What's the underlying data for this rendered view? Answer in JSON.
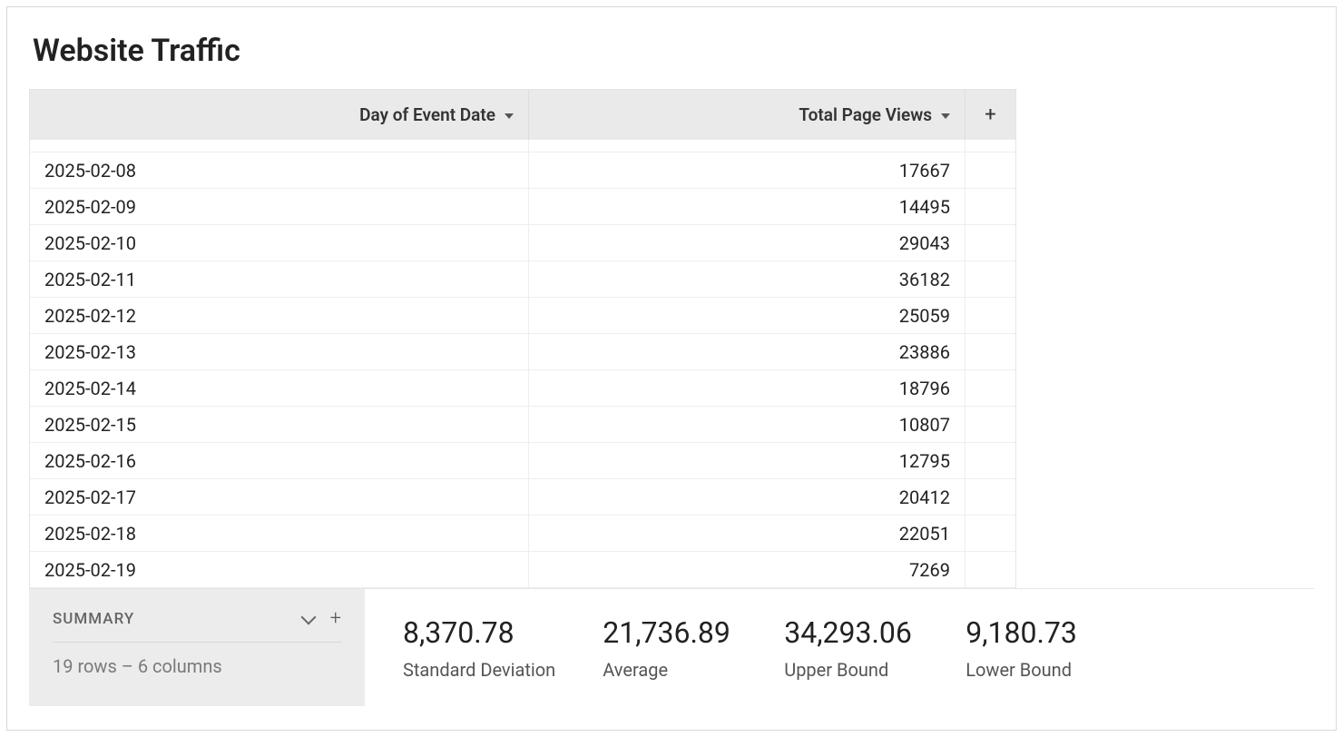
{
  "title": "Website Traffic",
  "columns": {
    "date": "Day of Event Date",
    "views": "Total Page Views"
  },
  "rows": [
    {
      "date": "2025-02-08",
      "views": "17667"
    },
    {
      "date": "2025-02-09",
      "views": "14495"
    },
    {
      "date": "2025-02-10",
      "views": "29043"
    },
    {
      "date": "2025-02-11",
      "views": "36182"
    },
    {
      "date": "2025-02-12",
      "views": "25059"
    },
    {
      "date": "2025-02-13",
      "views": "23886"
    },
    {
      "date": "2025-02-14",
      "views": "18796"
    },
    {
      "date": "2025-02-15",
      "views": "10807"
    },
    {
      "date": "2025-02-16",
      "views": "12795"
    },
    {
      "date": "2025-02-17",
      "views": "20412"
    },
    {
      "date": "2025-02-18",
      "views": "22051"
    },
    {
      "date": "2025-02-19",
      "views": "7269"
    }
  ],
  "summary": {
    "label": "SUMMARY",
    "meta": "19 rows – 6 columns",
    "stats": [
      {
        "value": "8,370.78",
        "label": "Standard Deviation"
      },
      {
        "value": "21,736.89",
        "label": "Average"
      },
      {
        "value": "34,293.06",
        "label": "Upper Bound"
      },
      {
        "value": "9,180.73",
        "label": "Lower Bound"
      }
    ]
  }
}
